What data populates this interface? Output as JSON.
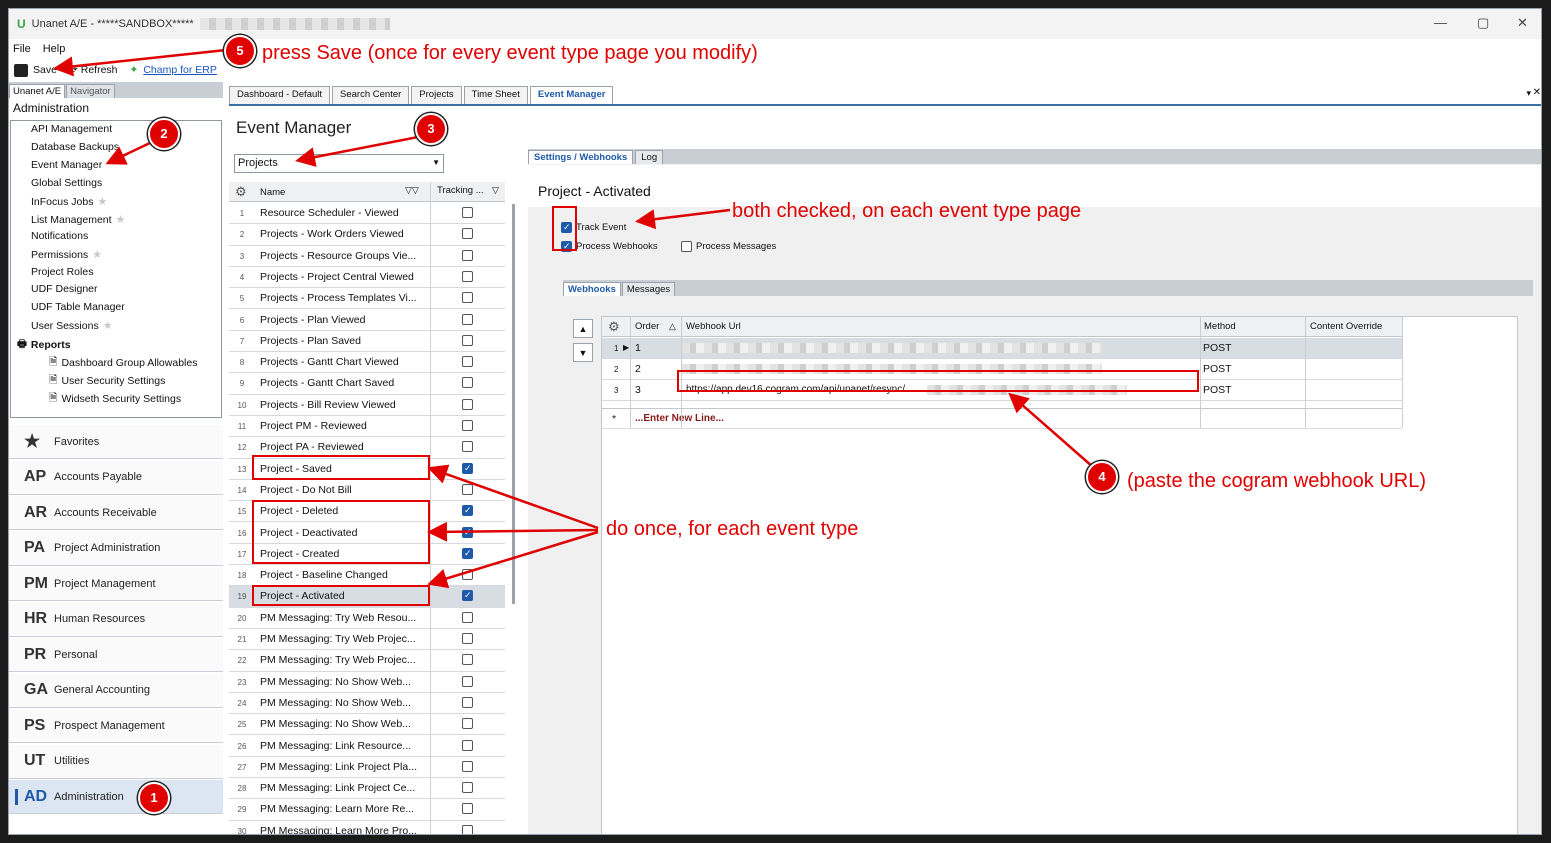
{
  "window": {
    "title": "Unanet A/E - *****SANDBOX*****"
  },
  "menu": [
    "File",
    "Help"
  ],
  "toolbar": {
    "save": "Save",
    "refresh": "Refresh",
    "champ": "Champ for ERP"
  },
  "left": {
    "tabs": [
      "Unanet A/E",
      "Navigator"
    ],
    "section": "Administration",
    "items": [
      "API Management",
      "Database Backups",
      "Event Manager",
      "Global Settings",
      "InFocus Jobs",
      "List Management",
      "Notifications",
      "Permissions",
      "Project Roles",
      "UDF Designer",
      "UDF Table Manager",
      "User Sessions"
    ],
    "reports": {
      "label": "Reports",
      "items": [
        "Dashboard Group Allowables",
        "User Security Settings",
        "Widseth Security Settings"
      ]
    },
    "nav": [
      {
        "ab": "",
        "label": "Favorites"
      },
      {
        "ab": "AP",
        "label": "Accounts Payable"
      },
      {
        "ab": "AR",
        "label": "Accounts Receivable"
      },
      {
        "ab": "PA",
        "label": "Project Administration"
      },
      {
        "ab": "PM",
        "label": "Project Management"
      },
      {
        "ab": "HR",
        "label": "Human Resources"
      },
      {
        "ab": "PR",
        "label": "Personal"
      },
      {
        "ab": "GA",
        "label": "General Accounting"
      },
      {
        "ab": "PS",
        "label": "Prospect Management"
      },
      {
        "ab": "UT",
        "label": "Utilities"
      },
      {
        "ab": "AD",
        "label": "Administration"
      }
    ]
  },
  "tabs": [
    "Dashboard - Default",
    "Search Center",
    "Projects",
    "Time Sheet",
    "Event Manager"
  ],
  "event_manager": {
    "title": "Event Manager",
    "dropdown": "Projects",
    "grid_headers": {
      "name": "Name",
      "tracking": "Tracking ..."
    },
    "rows": [
      {
        "n": "1",
        "name": "Resource Scheduler - Viewed",
        "on": false
      },
      {
        "n": "2",
        "name": "Projects - Work Orders Viewed",
        "on": false
      },
      {
        "n": "3",
        "name": "Projects - Resource Groups Vie...",
        "on": false
      },
      {
        "n": "4",
        "name": "Projects - Project Central Viewed",
        "on": false
      },
      {
        "n": "5",
        "name": "Projects - Process Templates Vi...",
        "on": false
      },
      {
        "n": "6",
        "name": "Projects - Plan Viewed",
        "on": false
      },
      {
        "n": "7",
        "name": "Projects - Plan Saved",
        "on": false
      },
      {
        "n": "8",
        "name": "Projects - Gantt Chart Viewed",
        "on": false
      },
      {
        "n": "9",
        "name": "Projects - Gantt Chart Saved",
        "on": false
      },
      {
        "n": "10",
        "name": "Projects - Bill Review Viewed",
        "on": false
      },
      {
        "n": "11",
        "name": "Project PM - Reviewed",
        "on": false
      },
      {
        "n": "12",
        "name": "Project PA - Reviewed",
        "on": false
      },
      {
        "n": "13",
        "name": "Project - Saved",
        "on": true
      },
      {
        "n": "14",
        "name": "Project - Do Not Bill",
        "on": false
      },
      {
        "n": "15",
        "name": "Project - Deleted",
        "on": true
      },
      {
        "n": "16",
        "name": "Project - Deactivated",
        "on": true
      },
      {
        "n": "17",
        "name": "Project - Created",
        "on": true
      },
      {
        "n": "18",
        "name": "Project - Baseline Changed",
        "on": false
      },
      {
        "n": "19",
        "name": "Project - Activated",
        "on": true
      },
      {
        "n": "20",
        "name": "PM Messaging: Try Web Resou...",
        "on": false
      },
      {
        "n": "21",
        "name": "PM Messaging: Try Web Projec...",
        "on": false
      },
      {
        "n": "22",
        "name": "PM Messaging: Try Web Projec...",
        "on": false
      },
      {
        "n": "23",
        "name": "PM Messaging: No Show Web...",
        "on": false
      },
      {
        "n": "24",
        "name": "PM Messaging: No Show Web...",
        "on": false
      },
      {
        "n": "25",
        "name": "PM Messaging: No Show Web...",
        "on": false
      },
      {
        "n": "26",
        "name": "PM Messaging: Link Resource...",
        "on": false
      },
      {
        "n": "27",
        "name": "PM Messaging: Link Project Pla...",
        "on": false
      },
      {
        "n": "28",
        "name": "PM Messaging: Link Project Ce...",
        "on": false
      },
      {
        "n": "29",
        "name": "PM Messaging: Learn More Re...",
        "on": false
      },
      {
        "n": "30",
        "name": "PM Messaging: Learn More Pro...",
        "on": false
      }
    ]
  },
  "detail": {
    "tabs": [
      "Settings / Webhooks",
      "Log"
    ],
    "title": "Project - Activated",
    "track_event": "Track Event",
    "process_webhooks": "Process Webhooks",
    "process_messages": "Process Messages",
    "subtabs": [
      "Webhooks",
      "Messages"
    ],
    "headers": {
      "order": "Order",
      "url": "Webhook Url",
      "method": "Method",
      "override": "Content Override"
    },
    "rows": [
      {
        "n": "1",
        "order": "1",
        "url": "",
        "method": "POST"
      },
      {
        "n": "2",
        "order": "2",
        "url": "",
        "method": "POST"
      },
      {
        "n": "3",
        "order": "3",
        "url": "https://app.dev16.cogram.com/api/unanet/resync/",
        "method": "POST"
      }
    ],
    "new_line": "...Enter New Line..."
  },
  "annotations": {
    "a1": "1",
    "a2": "2",
    "a3": "3",
    "a4": "4",
    "a5": "5",
    "t5": "press Save (once for every event type page you modify)",
    "tboth": "both checked, on each event type page",
    "tonce": "do once, for each event type",
    "t4": "(paste the cogram webhook URL)"
  }
}
